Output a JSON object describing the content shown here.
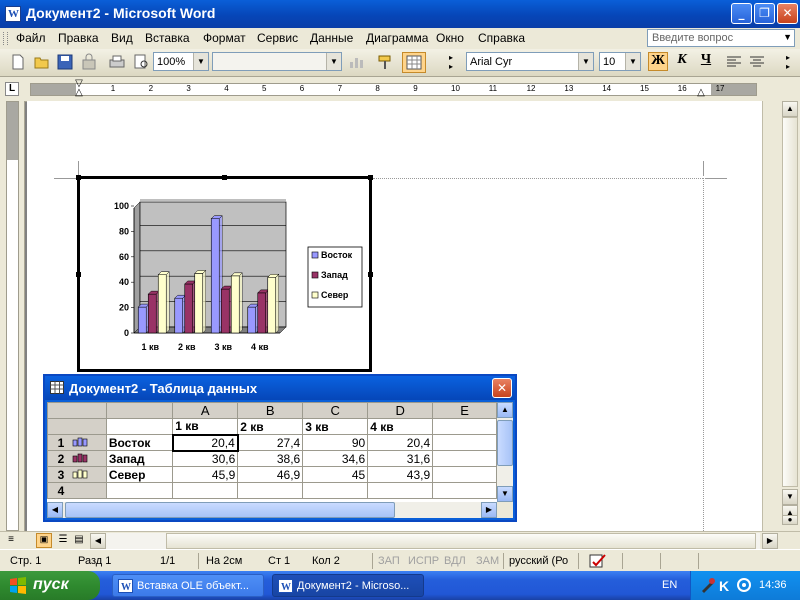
{
  "window": {
    "title": "Документ2 - Microsoft Word",
    "controls": {
      "minimize": "_",
      "maximize": "❐",
      "close": "✕"
    }
  },
  "menu": {
    "items": [
      "Файл",
      "Правка",
      "Вид",
      "Вставка",
      "Формат",
      "Сервис",
      "Данные",
      "Диаграмма",
      "Окно",
      "Справка"
    ],
    "ask_placeholder": "Введите вопрос"
  },
  "toolbar": {
    "zoom": "100%",
    "font_name": "Arial Cyr",
    "font_size": "10",
    "bold_label": "Ж",
    "italic_label": "К",
    "underline_label": "Ч"
  },
  "ruler": {
    "numbers": [
      "1",
      "2",
      "3",
      "4",
      "5",
      "6",
      "7",
      "8",
      "9",
      "10",
      "11",
      "12",
      "13",
      "14",
      "15",
      "16",
      "17"
    ]
  },
  "chart_data": {
    "type": "bar",
    "categories": [
      "1 кв",
      "2 кв",
      "3 кв",
      "4 кв"
    ],
    "series": [
      {
        "name": "Восток",
        "values": [
          20.4,
          27.4,
          90,
          20.4
        ],
        "color": "#9999ff"
      },
      {
        "name": "Запад",
        "values": [
          30.6,
          38.6,
          34.6,
          31.6
        ],
        "color": "#993366"
      },
      {
        "name": "Север",
        "values": [
          45.9,
          46.9,
          45,
          43.9
        ],
        "color": "#ffffcc"
      }
    ],
    "yticks": [
      "0",
      "20",
      "40",
      "60",
      "80",
      "100"
    ],
    "ylim": [
      0,
      100
    ],
    "grid": true,
    "legend": "right",
    "title": "",
    "xlabel": "",
    "ylabel": ""
  },
  "datasheet": {
    "title": "Документ2 - Таблица данных",
    "columns": [
      "A",
      "B",
      "C",
      "D",
      "E"
    ],
    "header_row": [
      "1 кв",
      "2 кв",
      "3 кв",
      "4 кв",
      ""
    ],
    "rows": [
      {
        "num": "1",
        "label": "Восток",
        "values": [
          "20,4",
          "27,4",
          "90",
          "20,4",
          ""
        ]
      },
      {
        "num": "2",
        "label": "Запад",
        "values": [
          "30,6",
          "38,6",
          "34,6",
          "31,6",
          ""
        ]
      },
      {
        "num": "3",
        "label": "Север",
        "values": [
          "45,9",
          "46,9",
          "45",
          "43,9",
          ""
        ]
      },
      {
        "num": "4",
        "label": "",
        "values": [
          "",
          "",
          "",
          "",
          ""
        ]
      }
    ]
  },
  "status": {
    "page": "Стр. 1",
    "section": "Разд 1",
    "pages": "1/1",
    "at": "На 2см",
    "line": "Ст 1",
    "col": "Кол 2",
    "rec": "ЗАП",
    "trk": "ИСПР",
    "ext": "ВДЛ",
    "ovr": "ЗАМ",
    "lang": "русский (Ро"
  },
  "taskbar": {
    "start_label": "пуск",
    "tasks": [
      "Вставка OLE объект...",
      "Документ2 - Microso..."
    ],
    "lang": "EN",
    "clock": "14:36"
  },
  "colors": {
    "xp_blue": "#0a5fd8",
    "chrome": "#ece9d8",
    "chart_plot_bg": "#c0c0c0"
  }
}
